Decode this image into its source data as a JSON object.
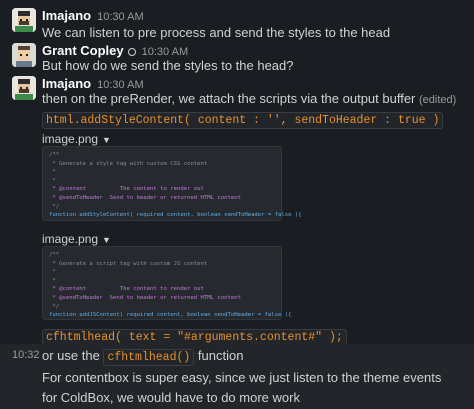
{
  "messages": [
    {
      "author": "Imajano",
      "time": "10:30 AM",
      "text": "We can listen to pre process and send the styles to the head"
    },
    {
      "author": "Grant Copley",
      "time": "10:30 AM",
      "text": "But how do we send the styles to the head?"
    },
    {
      "author": "Imajano",
      "time": "10:30 AM",
      "text": "then on the preRender,  we attach the scripts via the output buffer",
      "edited": "(edited)",
      "code_snippet_1": "html.addStyleContent( content : '', sendToHeader : true )",
      "image1_label": "image.png",
      "image1_caret": "▼",
      "image2_label": "image.png",
      "image2_caret": "▼",
      "code_snippet_2": "cfhtmlhead( text = \"#arguments.content#\" );"
    }
  ],
  "code_image_1": {
    "lines": [
      "/**",
      " * Generate a style tag with custom CSS content",
      " *",
      " *",
      " * @content          The content to render out",
      " * @sendToHeader  Send to header or returned HTML content",
      " */",
      "function addStyleContent( required content, boolean sendToHeader = false ){"
    ]
  },
  "code_image_2": {
    "lines": [
      "/**",
      " * Generate a script tag with custom JS content",
      " *",
      " *",
      " * @content          The content to render out",
      " * @sendToHeader  Send to header or returned HTML content",
      " */",
      "function addJSContent( required content, boolean sendToHeader = false ){"
    ]
  },
  "followups": [
    {
      "side_time": "10:32",
      "text_before": "or use the",
      "code": "cfhtmlhead()",
      "text_after": "function"
    },
    {
      "text": "For contentbox is super easy, since we just listen to the theme events"
    },
    {
      "text": "for ColdBox, we would have to do more work"
    }
  ]
}
